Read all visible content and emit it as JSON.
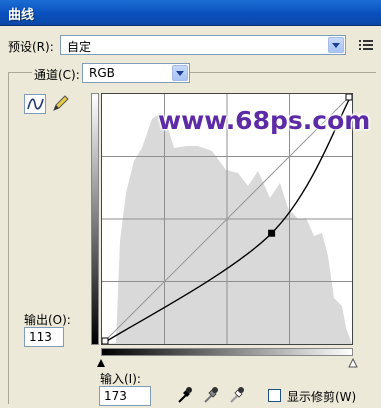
{
  "window": {
    "title": "曲线"
  },
  "preset": {
    "label": "预设(R):",
    "value": "自定"
  },
  "channel": {
    "label": "通道(C):",
    "value": "RGB"
  },
  "output": {
    "label": "输出(O):",
    "value": "113"
  },
  "input": {
    "label": "输入(I):",
    "value": "173"
  },
  "show_clipping": {
    "label": "显示修剪(W)",
    "checked": false
  },
  "watermark": {
    "text": "www.68ps.com"
  },
  "curve": {
    "points": [
      {
        "input": 0,
        "output": 0
      },
      {
        "input": 173,
        "output": 113
      },
      {
        "input": 255,
        "output": 255
      }
    ],
    "selected_point": {
      "input": 173,
      "output": 113
    }
  },
  "colors": {
    "titlebar": "#0a50bd",
    "watermark": "#5d2ba6",
    "histogram": "#d9d9d9"
  },
  "icons": {
    "preset_menu": "options-list-icon",
    "curve_tool": "curve-tool-icon",
    "pencil_tool": "pencil-icon",
    "eyedroppers": [
      "black-eyedropper-icon",
      "gray-eyedropper-icon",
      "white-eyedropper-icon"
    ]
  }
}
